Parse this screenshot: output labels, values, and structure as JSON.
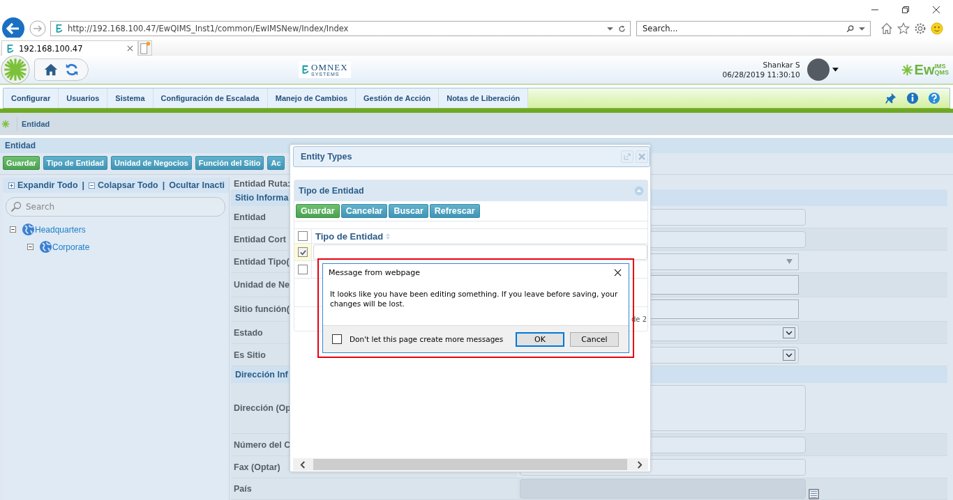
{
  "browser": {
    "address": "http://192.168.100.47/EwQIMS_Inst1/common/EwIMSNew/Index/Index",
    "search_placeholder": "Search...",
    "tab": "192.168.100.47"
  },
  "header": {
    "omnex_name": "OMNEX",
    "omnex_tagline": "SYSTEMS",
    "user": "Shankar S",
    "datetime": "06/28/2019 11:30:10",
    "brand_main": "Ew",
    "brand_top": "IMS",
    "brand_bottom": "QMS"
  },
  "nav": [
    "Configurar",
    "Usuarios",
    "Sistema",
    "Configuración de Escalada",
    "Manejo de Cambios",
    "Gestión de Acción",
    "Notas de Liberación"
  ],
  "breadcrumb": "Entidad",
  "panel": {
    "title": "Entidad",
    "buttons": [
      {
        "label": "Guardar",
        "kind": "primary"
      },
      {
        "label": "Tipo de Entidad",
        "kind": "secondary"
      },
      {
        "label": "Unidad de Negocios",
        "kind": "secondary"
      },
      {
        "label": "Función del Sitio",
        "kind": "secondary"
      },
      {
        "label": "Ac",
        "kind": "secondary"
      }
    ]
  },
  "tree": {
    "toolbar": [
      {
        "label": "Expandir Todo",
        "kind": "expand"
      },
      {
        "label": "Colapsar Todo",
        "kind": "collapse"
      },
      {
        "label": "Ocultar Inacti",
        "kind": "plain"
      }
    ],
    "separators": [
      "|",
      "|"
    ],
    "search_placeholder": "Search",
    "nodes": [
      {
        "label": "Headquarters",
        "expanded": true,
        "children": [
          {
            "label": "Corporate",
            "expanded": true
          }
        ]
      }
    ]
  },
  "form": {
    "path_label": "Entidad Ruta:",
    "sections": [
      {
        "title": "Sitio Informa",
        "rows": [
          {
            "label": "Entidad",
            "kind": "text"
          },
          {
            "label": "Entidad Cort",
            "kind": "text"
          },
          {
            "label": "Entidad Tipo(",
            "kind": "combo"
          },
          {
            "label": "Unidad de Ne",
            "kind": "box"
          },
          {
            "label": "Sitio función(",
            "kind": "box"
          },
          {
            "label": "Estado",
            "kind": "select"
          },
          {
            "label": "Es Sitio",
            "kind": "select"
          }
        ]
      },
      {
        "title": "Dirección Inf",
        "rows": [
          {
            "label": "Dirección (Op",
            "kind": "textarea"
          },
          {
            "label": "Número del C",
            "kind": "text"
          },
          {
            "label": "Fax (Optar)",
            "kind": "text"
          },
          {
            "label": "País",
            "kind": "lookup"
          }
        ]
      }
    ]
  },
  "dialog": {
    "title": "Entity Types",
    "panel_title": "Tipo de Entidad",
    "buttons": [
      {
        "label": "Guardar",
        "kind": "primary"
      },
      {
        "label": "Cancelar",
        "kind": "secondary"
      },
      {
        "label": "Buscar",
        "kind": "secondary"
      },
      {
        "label": "Refrescar",
        "kind": "secondary"
      }
    ],
    "column": "Tipo de Entidad",
    "header_checked": false,
    "rows": [
      {
        "checked": true,
        "kind": "edit"
      },
      {
        "checked": false,
        "kind": "plain"
      }
    ],
    "pager": "de 2"
  },
  "message": {
    "title": "Message from webpage",
    "text": "It looks like you have been editing something. If you leave before saving, your changes will be lost.",
    "checkbox_label": "Don't let this page create more messages",
    "checkbox_checked": false,
    "buttons": [
      {
        "label": "OK",
        "selected": true
      },
      {
        "label": "Cancel",
        "selected": false
      }
    ]
  }
}
